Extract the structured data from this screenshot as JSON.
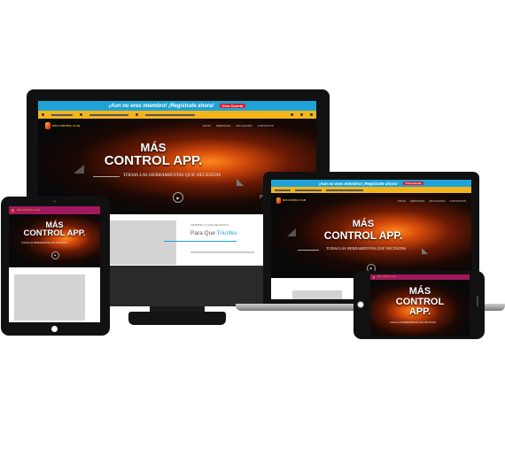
{
  "site": {
    "topbar_text": "¡Aun no eres miembro! ¡Registrate ahora!",
    "topbar_cta": "Crea Cuenta",
    "logo_text": "MÁS CONTROL CLUB",
    "nav_items": [
      "INICIO",
      "SERVICIOS",
      "APLICACIÓN",
      "CONTACTOS"
    ],
    "hero_title_line1": "MÁS",
    "hero_title_line2": "CONTROL APP.",
    "hero_subtitle": "TODAS LAS HERRAMIENTAS QUE NECESITAS",
    "section_eyebrow": "SIEMPRE LO QUE NECESITAS",
    "section_title_prefix": "Para Que",
    "section_title_accent": "Triunfes",
    "play_icon": "play-icon"
  },
  "colors": {
    "topbar_blue": "#1fa2d6",
    "cta_red": "#e3192a",
    "info_yellow": "#f3b41c",
    "mobile_bar_magenta": "#a0195e",
    "accent_blue": "#1fa2d6",
    "device_black": "#111111"
  },
  "devices": [
    "desktop-monitor",
    "laptop",
    "tablet",
    "phone"
  ]
}
